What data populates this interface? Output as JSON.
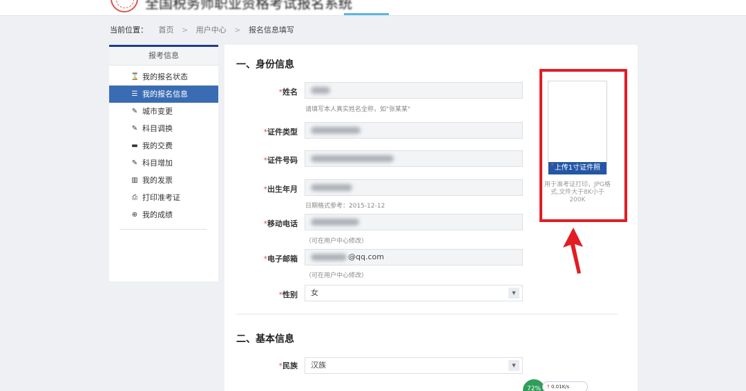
{
  "header": {
    "site_title": "全国税务师职业资格考试报名系统"
  },
  "breadcrumb": {
    "label": "当前位置：",
    "items": [
      "首页",
      "用户中心",
      "报名信息填写"
    ],
    "separator": ">"
  },
  "sidebar": {
    "title": "报考信息",
    "items": [
      {
        "label": "我的报名状态",
        "icon": "hourglass-icon",
        "glyph": "⌛",
        "active": false
      },
      {
        "label": "我的报名信息",
        "icon": "list-icon",
        "glyph": "☰",
        "active": true
      },
      {
        "label": "城市变更",
        "icon": "edit-icon",
        "glyph": "✎",
        "active": false
      },
      {
        "label": "科目调换",
        "icon": "edit-icon",
        "glyph": "✎",
        "active": false
      },
      {
        "label": "我的交费",
        "icon": "card-icon",
        "glyph": "▬",
        "active": false
      },
      {
        "label": "科目增加",
        "icon": "edit-icon",
        "glyph": "✎",
        "active": false
      },
      {
        "label": "我的发票",
        "icon": "barcode-icon",
        "glyph": "▥",
        "active": false
      },
      {
        "label": "打印准考证",
        "icon": "print-icon",
        "glyph": "⎙",
        "active": false
      },
      {
        "label": "我的成绩",
        "icon": "zoom-icon",
        "glyph": "⊕",
        "active": false
      }
    ]
  },
  "form": {
    "section1_title": "一、身份信息",
    "section2_title": "二、基本信息",
    "name": {
      "label": "姓名",
      "value": "",
      "hint": "请填写本人真实姓名全称，如\"张某某\""
    },
    "id_type": {
      "label": "证件类型",
      "value": ""
    },
    "id_number": {
      "label": "证件号码",
      "value": ""
    },
    "birth": {
      "label": "出生年月",
      "value": "",
      "hint": "日期格式参考：2015-12-12"
    },
    "phone": {
      "label": "移动电话",
      "value": "",
      "hint": "（可在用户中心修改）"
    },
    "email": {
      "label": "电子邮箱",
      "visible_part": "@qq.com",
      "hint": "（可在用户中心修改）"
    },
    "gender": {
      "label": "性别",
      "value": "女"
    },
    "ethnicity": {
      "label": "民族",
      "value": "汉族"
    },
    "required_mark": "*",
    "select_arrow": "▼"
  },
  "photo": {
    "upload_label": "上传1寸证件照",
    "hint": "用于准考证打印，JPG格式,文件大于8K小于200K"
  },
  "speed_widget": {
    "percent": "72%",
    "speed": "0.01K/s",
    "up_glyph": "↑"
  },
  "colors": {
    "annotation": "#e31c23",
    "sidebar_active": "#3a6cb3",
    "upload_button": "#2356a6"
  }
}
